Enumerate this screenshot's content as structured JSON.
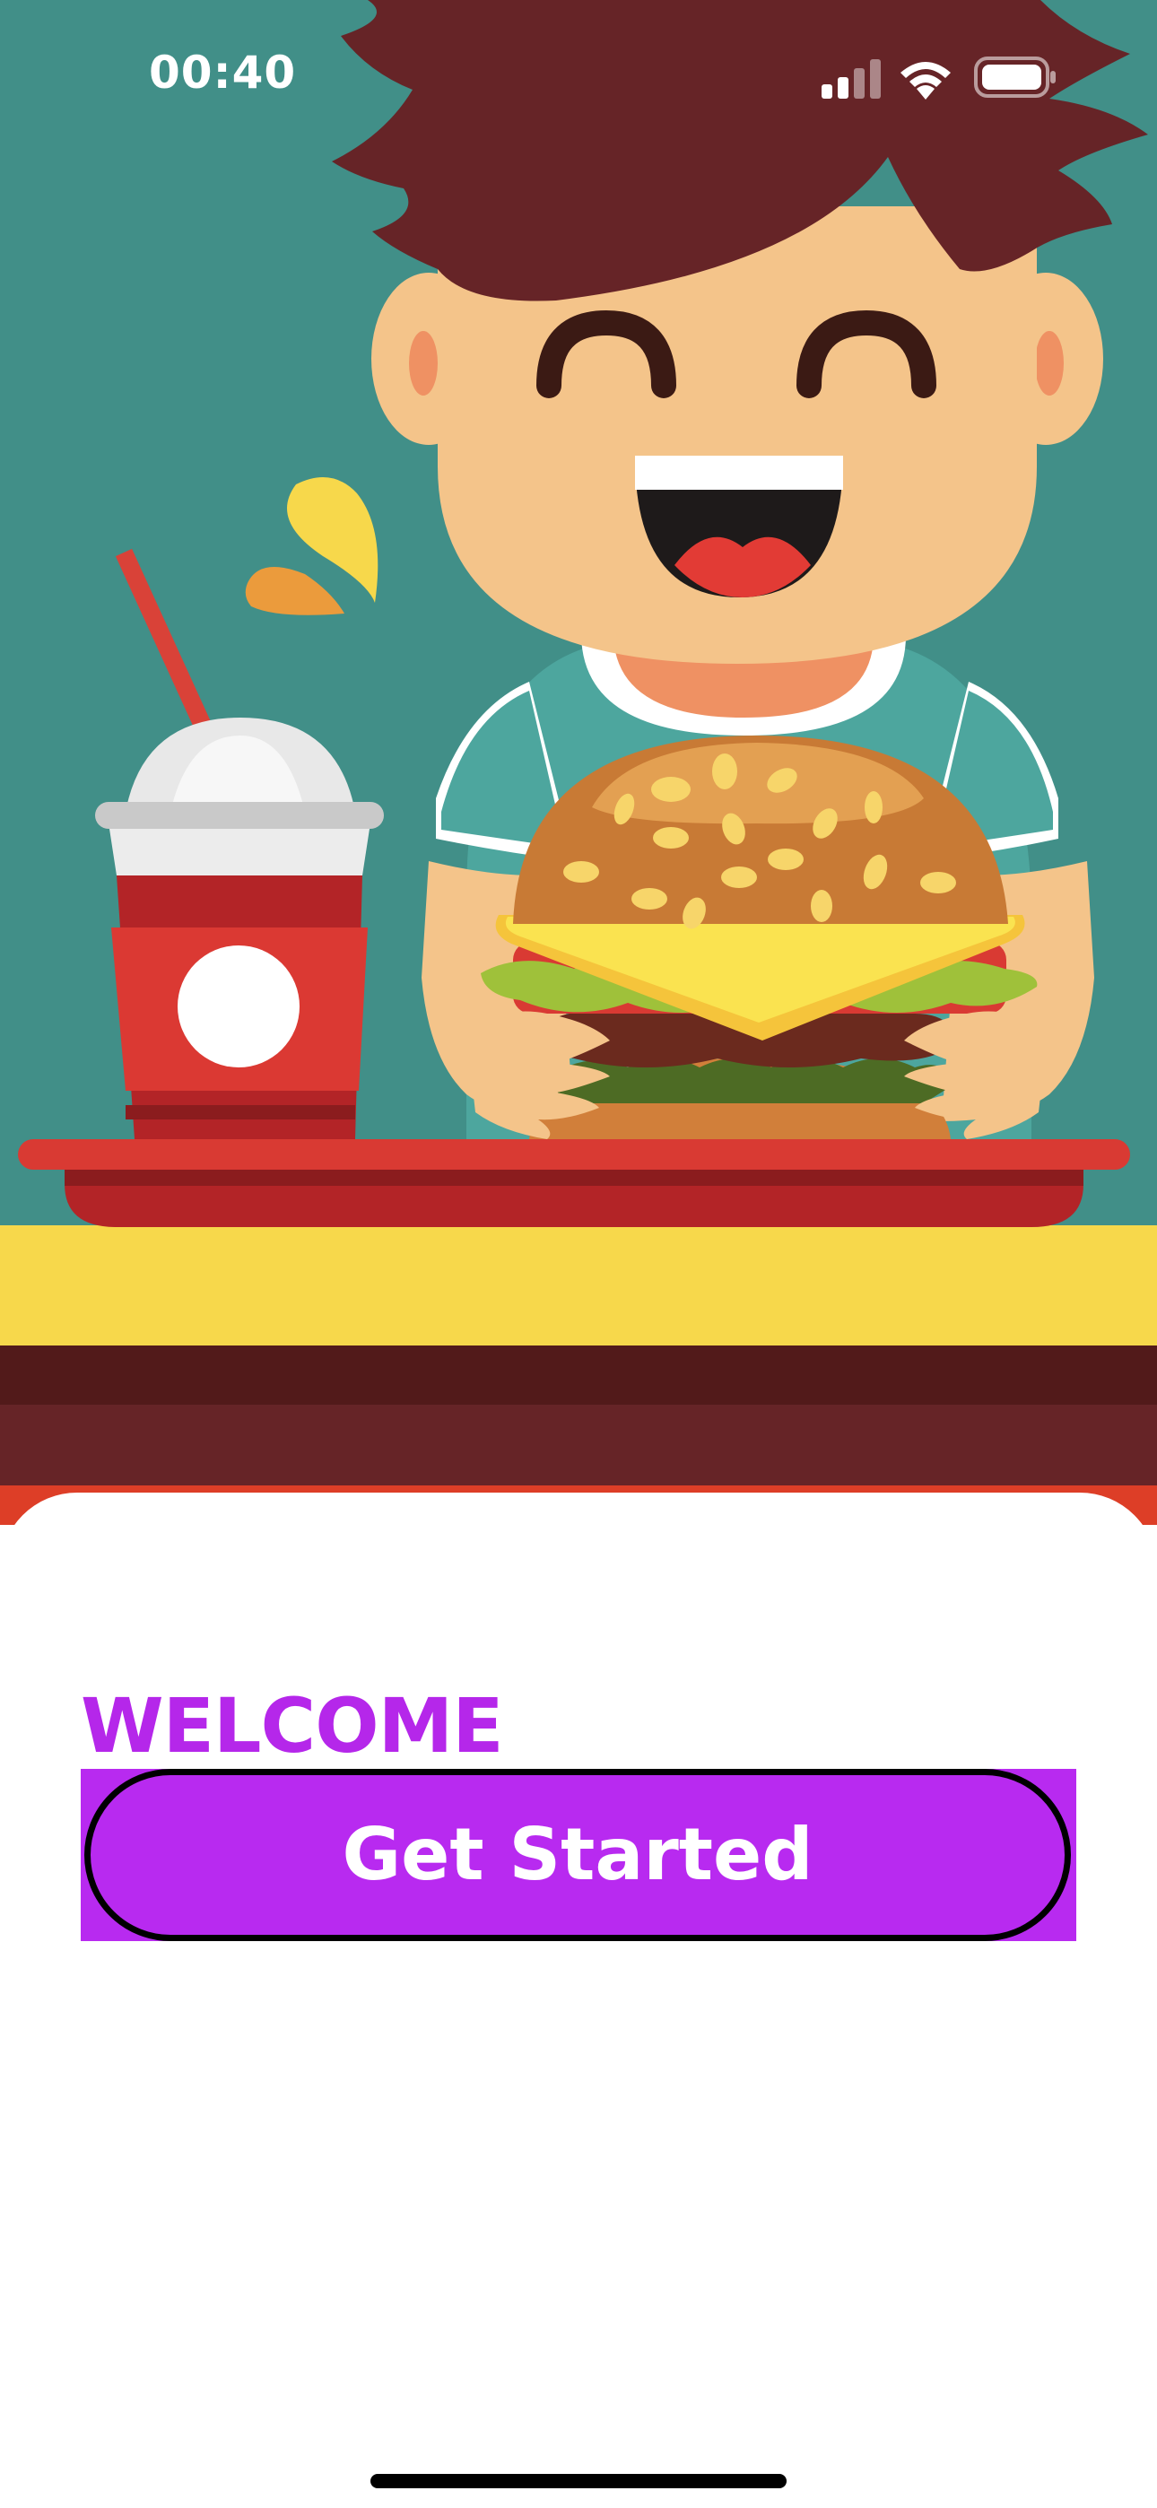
{
  "status_bar": {
    "time": "00:40",
    "signal_icon": "cellular-signal-icon",
    "wifi_icon": "wifi-icon",
    "battery_icon": "battery-icon"
  },
  "hero": {
    "illustration": "boy-eating-burger-illustration",
    "colors": {
      "background": "#418f88",
      "hair": "#662427",
      "skin": "#f4c48a",
      "shirt": "#4da69e",
      "tray": "#d93a33",
      "counter_yellow": "#f7d84b",
      "counter_brown": "#521a1a"
    }
  },
  "welcome": {
    "title": "WELCOME",
    "get_started_label": "Get Started"
  },
  "colors": {
    "accent": "#b82af0",
    "title": "#b527ea"
  }
}
